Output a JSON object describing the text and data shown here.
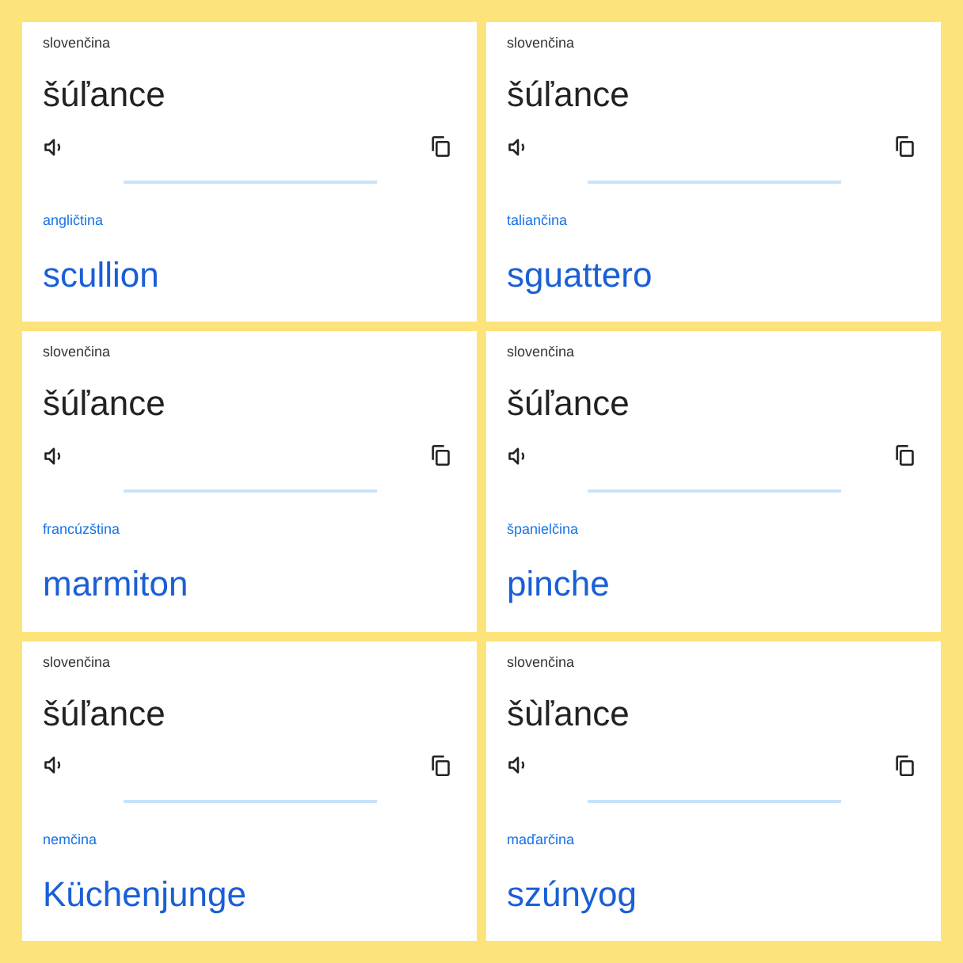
{
  "cards": [
    {
      "source_language": "slovenčina",
      "source_text": "šúľance",
      "target_language": "angličtina",
      "target_text": "scullion"
    },
    {
      "source_language": "slovenčina",
      "source_text": "šúľance",
      "target_language": "taliančina",
      "target_text": "sguattero"
    },
    {
      "source_language": "slovenčina",
      "source_text": "šúľance",
      "target_language": "francúzština",
      "target_text": "marmiton"
    },
    {
      "source_language": "slovenčina",
      "source_text": "šúľance",
      "target_language": "španielčina",
      "target_text": "pinche"
    },
    {
      "source_language": "slovenčina",
      "source_text": "šúľance",
      "target_language": "nemčina",
      "target_text": "Küchenjunge"
    },
    {
      "source_language": "slovenčina",
      "source_text": "šùľance",
      "target_language": "maďarčina",
      "target_text": "szúnyog"
    }
  ]
}
